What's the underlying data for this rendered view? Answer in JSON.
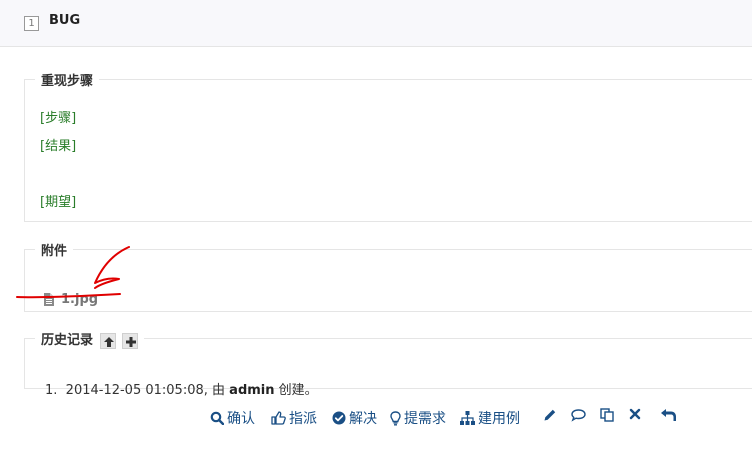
{
  "header": {
    "id": "1",
    "title": "BUG"
  },
  "steps": {
    "legend": "重现步骤",
    "lines": [
      "[步骤]",
      "[结果]",
      "[期望]"
    ]
  },
  "files": {
    "legend": "附件",
    "items": [
      {
        "name": "1.jpg",
        "icon": "file-icon"
      }
    ]
  },
  "history": {
    "legend": "历史记录",
    "buttons": [
      "arrow-up-icon",
      "plus-icon"
    ],
    "entries": [
      {
        "index": "1.",
        "time": "2014-12-05 01:05:08,",
        "by": "由",
        "user": "admin",
        "action": "创建。"
      }
    ]
  },
  "actions": [
    {
      "label": "确认",
      "icon": "search-icon"
    },
    {
      "label": "指派",
      "icon": "hand-point-icon"
    },
    {
      "label": "解决",
      "icon": "check-circle-icon"
    },
    {
      "label": "提需求",
      "icon": "lightbulb-icon"
    },
    {
      "label": "建用例",
      "icon": "sitemap-icon"
    },
    {
      "label": "",
      "icon": "pencil-icon"
    },
    {
      "label": "",
      "icon": "comment-icon"
    },
    {
      "label": "",
      "icon": "copy-icon"
    },
    {
      "label": "",
      "icon": "close-icon"
    },
    {
      "label": "",
      "icon": "back-icon"
    }
  ],
  "colors": {
    "link": "#1a4f85",
    "template_text": "#2a7d2a",
    "annotation": "#e00000"
  }
}
